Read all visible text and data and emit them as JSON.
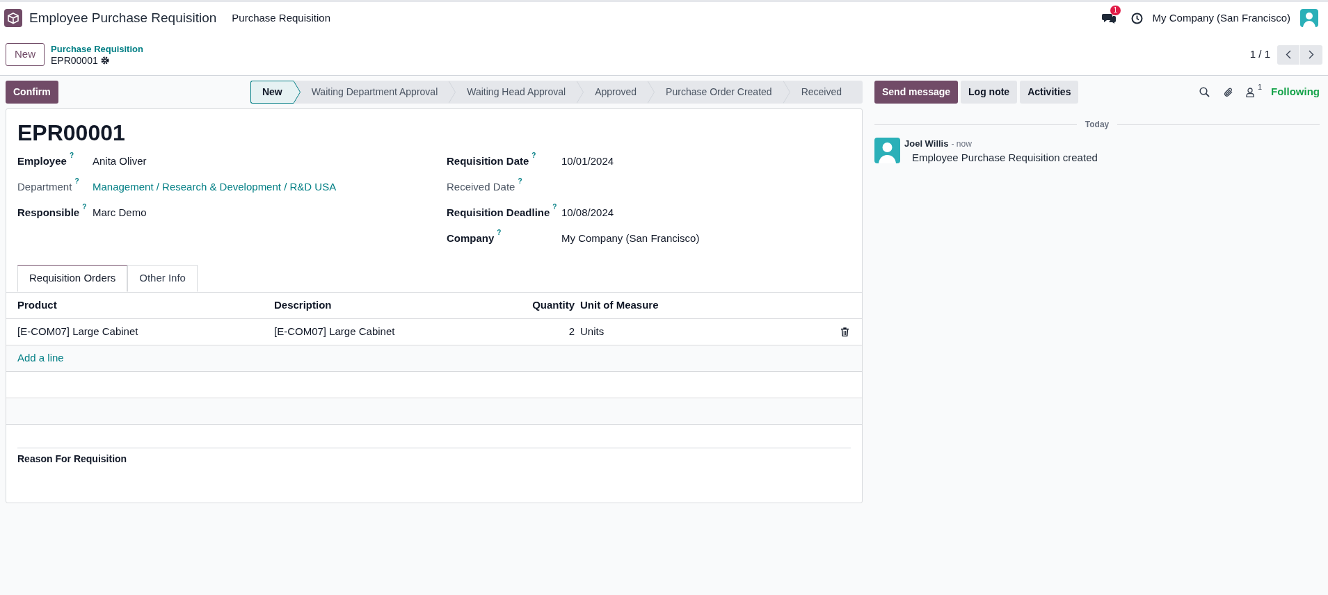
{
  "navbar": {
    "app_title": "Employee Purchase Requisition",
    "menus": [
      "Purchase Requisition"
    ],
    "messages_badge": "1",
    "company": "My Company (San Francisco)"
  },
  "control_panel": {
    "new_button": "New",
    "breadcrumb": "Purchase Requisition",
    "record": "EPR00001",
    "pager": "1 / 1"
  },
  "actions": {
    "buttons": [
      "Confirm"
    ]
  },
  "statusbar": [
    {
      "label": "New",
      "selected": true
    },
    {
      "label": "Waiting Department Approval",
      "selected": false
    },
    {
      "label": "Waiting Head Approval",
      "selected": false
    },
    {
      "label": "Approved",
      "selected": false
    },
    {
      "label": "Purchase Order Created",
      "selected": false
    },
    {
      "label": "Received",
      "selected": false
    }
  ],
  "form": {
    "title": "EPR00001",
    "left_fields": [
      {
        "label": "Employee",
        "help": "?",
        "value": "Anita Oliver",
        "required": true,
        "kind": "text"
      },
      {
        "label": "Department",
        "help": "?",
        "value": "Management / Research & Development / R&D USA",
        "required": false,
        "kind": "link"
      },
      {
        "label": "Responsible",
        "help": "?",
        "value": "Marc Demo",
        "required": true,
        "kind": "text"
      }
    ],
    "right_fields": [
      {
        "label": "Requisition Date",
        "help": "?",
        "value": "10/01/2024",
        "required": true,
        "kind": "text"
      },
      {
        "label": "Received Date",
        "help": "?",
        "required": false,
        "kind": "text"
      },
      {
        "label": "Requisition Deadline",
        "help": "?",
        "value": "10/08/2024",
        "required": true,
        "kind": "text"
      },
      {
        "label": "Company",
        "help": "?",
        "value": "My Company (San Francisco)",
        "required": true,
        "kind": "text"
      }
    ],
    "tabs": [
      {
        "label": "Requisition Orders",
        "selected": true
      },
      {
        "label": "Other Info",
        "selected": false
      }
    ],
    "table": {
      "columns": [
        "Product",
        "Description",
        "Quantity",
        "Unit of Measure"
      ],
      "rows": [
        [
          "[E-COM07] Large Cabinet",
          "[E-COM07] Large Cabinet",
          "2",
          "Units"
        ]
      ],
      "add_line": "Add a line"
    },
    "reason_label": "Reason For Requisition"
  },
  "chatter": {
    "buttons": [
      {
        "label": "Send message",
        "selected": true
      },
      {
        "label": "Log note",
        "selected": false
      },
      {
        "label": "Activities",
        "selected": false
      }
    ],
    "followers_count": "1",
    "following": "Following",
    "date_separator": "Today",
    "messages": [
      {
        "author": "Joel Willis",
        "time": "- now",
        "body": "Employee Purchase Requisition created"
      }
    ]
  }
}
